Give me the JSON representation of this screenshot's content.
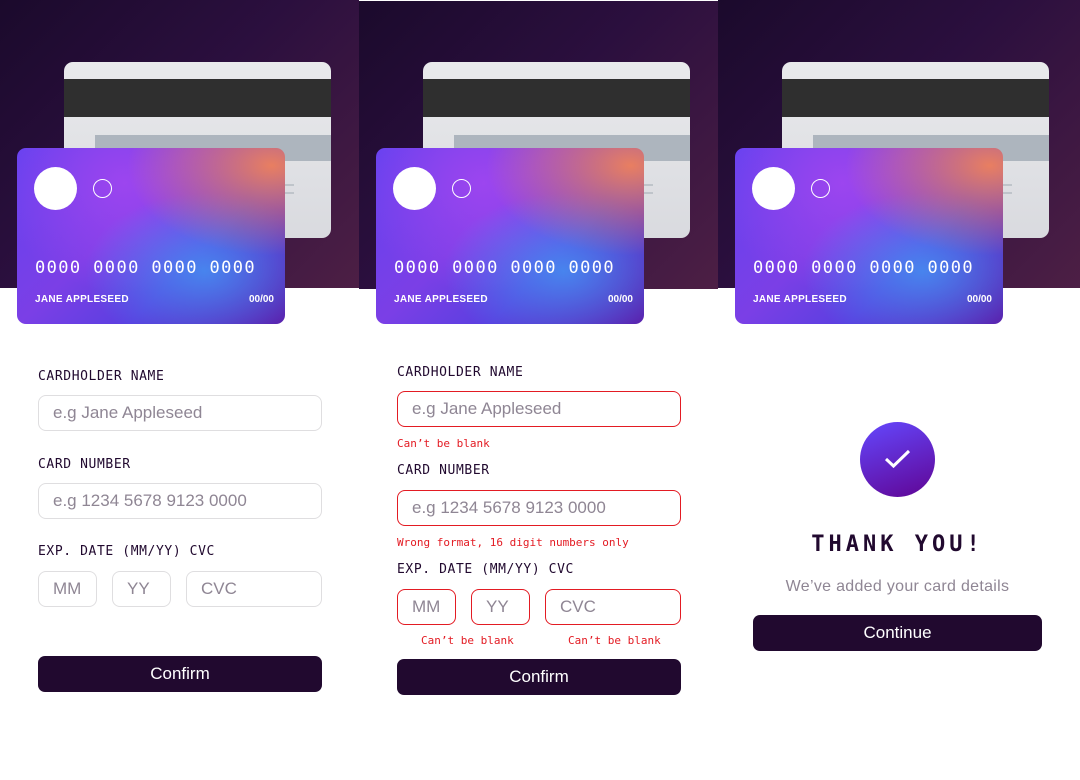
{
  "card": {
    "number": "0000 0000 0000 0000",
    "holder": "JANE APPLESEED",
    "expiry": "00/00"
  },
  "form": {
    "name_label": "CARDHOLDER NAME",
    "name_placeholder": "e.g Jane Appleseed",
    "number_label": "CARD NUMBER",
    "number_placeholder": "e.g 1234 5678 9123 0000",
    "exp_label": "EXP. DATE (MM/YY) CVC",
    "mm_placeholder": "MM",
    "yy_placeholder": "YY",
    "cvc_placeholder": "CVC",
    "confirm_label": "Confirm"
  },
  "errors": {
    "name": "Can’t be blank",
    "number": "Wrong format, 16 digit numbers only",
    "date": "Can’t be blank",
    "cvc": "Can’t be blank"
  },
  "thanks": {
    "title": "THANK YOU!",
    "subtitle": "We’ve added your card details",
    "continue_label": "Continue"
  },
  "colors": {
    "dark_violet": "#21092f",
    "error_red": "#e31b23",
    "placeholder_grey": "#8f8694"
  }
}
